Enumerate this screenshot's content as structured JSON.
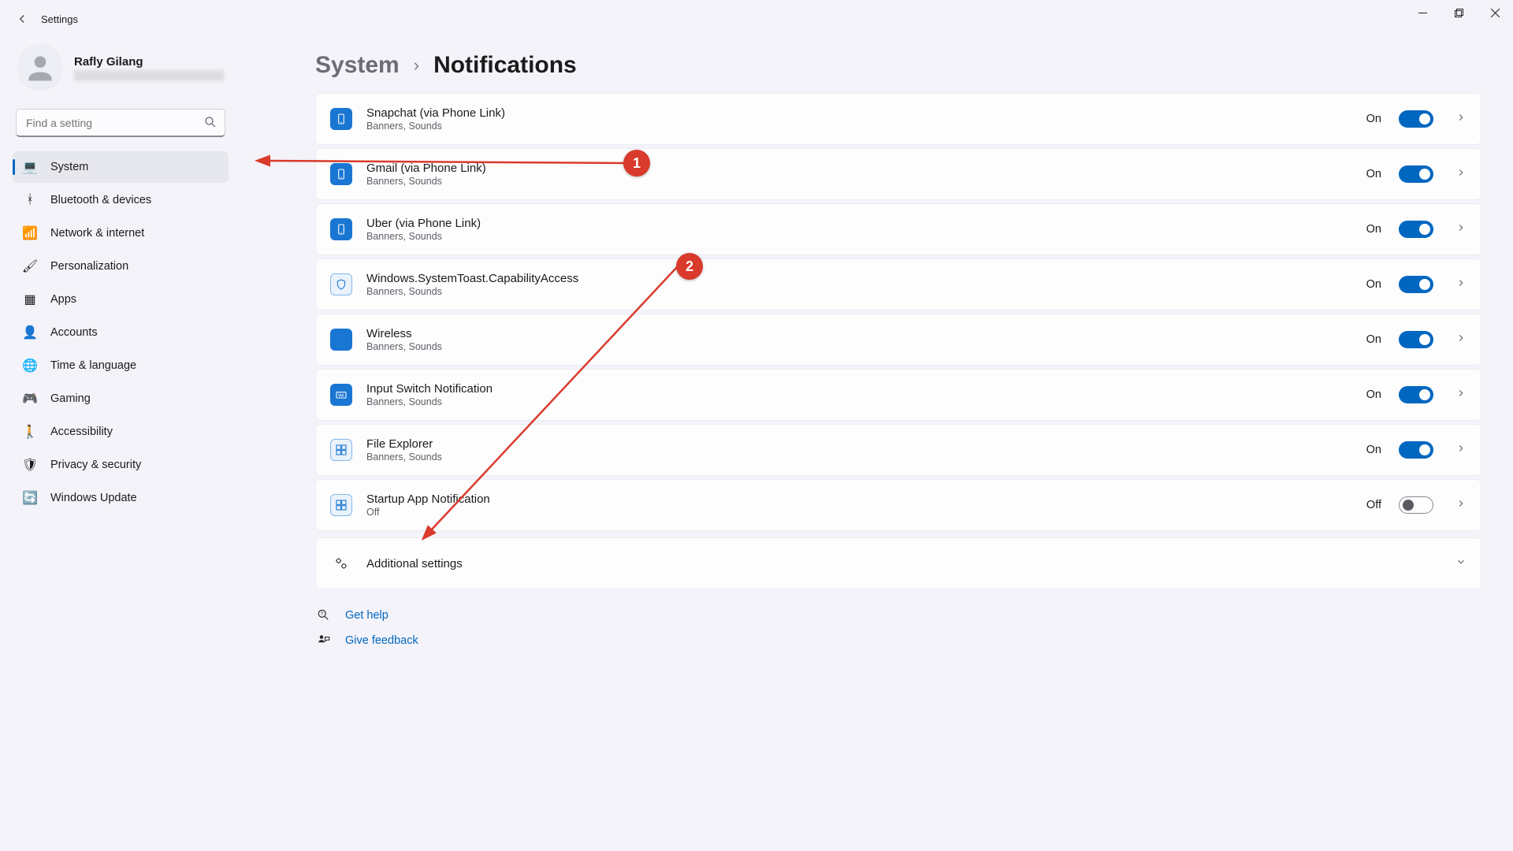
{
  "window": {
    "app_title": "Settings"
  },
  "profile": {
    "name": "Rafly Gilang"
  },
  "search": {
    "placeholder": "Find a setting"
  },
  "nav": {
    "items": [
      {
        "label": "System",
        "icon": "💻",
        "active": true
      },
      {
        "label": "Bluetooth & devices",
        "icon": "ᚼ",
        "active": false
      },
      {
        "label": "Network & internet",
        "icon": "📶",
        "active": false
      },
      {
        "label": "Personalization",
        "icon": "🖌",
        "active": false
      },
      {
        "label": "Apps",
        "icon": "▦",
        "active": false
      },
      {
        "label": "Accounts",
        "icon": "👤",
        "active": false
      },
      {
        "label": "Time & language",
        "icon": "🌐",
        "active": false
      },
      {
        "label": "Gaming",
        "icon": "🎮",
        "active": false
      },
      {
        "label": "Accessibility",
        "icon": "🚶",
        "active": false
      },
      {
        "label": "Privacy & security",
        "icon": "🛡",
        "active": false
      },
      {
        "label": "Windows Update",
        "icon": "🔄",
        "active": false
      }
    ]
  },
  "breadcrumb": {
    "parent": "System",
    "separator": "›",
    "current": "Notifications"
  },
  "apps": [
    {
      "name": "Snapchat (via Phone Link)",
      "sub": "Banners, Sounds",
      "state": "On",
      "on": true,
      "icon": "phone"
    },
    {
      "name": "Gmail (via Phone Link)",
      "sub": "Banners, Sounds",
      "state": "On",
      "on": true,
      "icon": "phone"
    },
    {
      "name": "Uber (via Phone Link)",
      "sub": "Banners, Sounds",
      "state": "On",
      "on": true,
      "icon": "phone"
    },
    {
      "name": "Windows.SystemToast.CapabilityAccess",
      "sub": "Banners, Sounds",
      "state": "On",
      "on": true,
      "icon": "shield"
    },
    {
      "name": "Wireless",
      "sub": "Banners, Sounds",
      "state": "On",
      "on": true,
      "icon": "solid"
    },
    {
      "name": "Input Switch Notification",
      "sub": "Banners, Sounds",
      "state": "On",
      "on": true,
      "icon": "kbd"
    },
    {
      "name": "File Explorer",
      "sub": "Banners, Sounds",
      "state": "On",
      "on": true,
      "icon": "grid"
    },
    {
      "name": "Startup App Notification",
      "sub": "Off",
      "state": "Off",
      "on": false,
      "icon": "grid"
    }
  ],
  "additional": {
    "label": "Additional settings"
  },
  "help": {
    "get_help": "Get help",
    "feedback": "Give feedback"
  },
  "annotations": {
    "badge1": "1",
    "badge2": "2"
  }
}
